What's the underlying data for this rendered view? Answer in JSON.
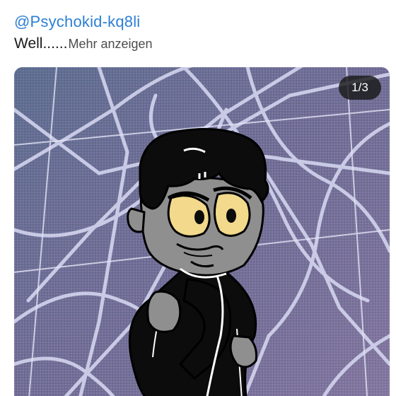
{
  "post": {
    "username": "@Psychokid-kq8li",
    "caption": "Well......",
    "more_label": "Mehr anzeigen"
  },
  "media": {
    "counter": "1/3",
    "current": 1,
    "total": 3,
    "description_icon": "drawing-image",
    "colors": {
      "background": "#6e6f93",
      "web": "#c9cbe8",
      "outfit": "#0c0c0c",
      "skin": "#8f8f8f",
      "eyes": "#f2d98c"
    }
  }
}
